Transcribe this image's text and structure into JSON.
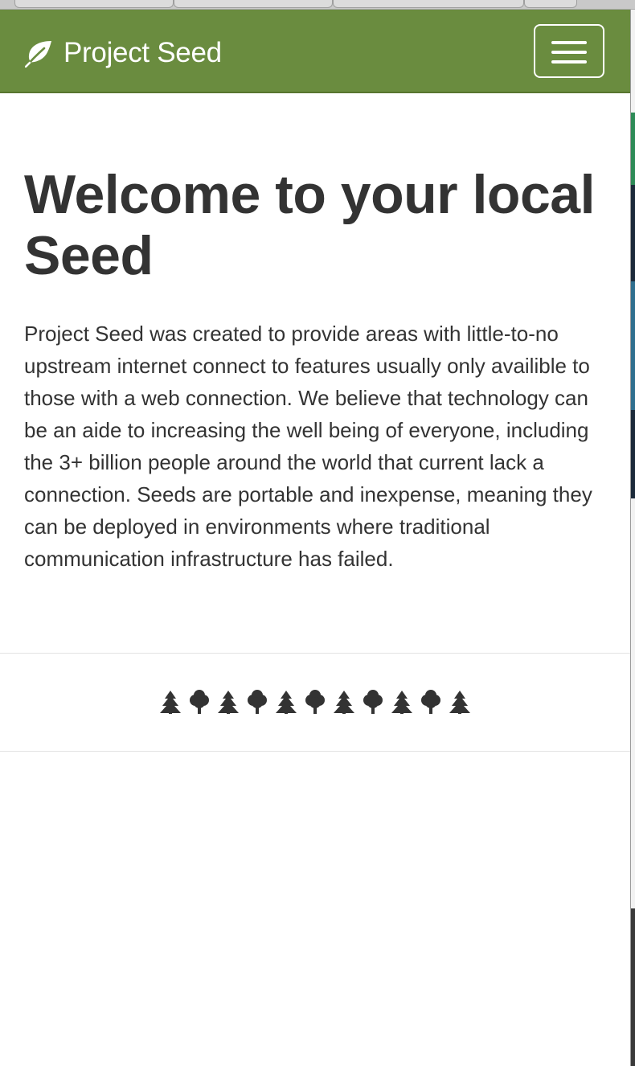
{
  "navbar": {
    "brand_icon": "leaf-icon",
    "brand_label": "Project Seed",
    "menu_icon": "hamburger-menu-icon",
    "background_color": "#6a8c3f"
  },
  "hero": {
    "headline": "Welcome to your local Seed",
    "intro": "Project Seed was created to provide areas with little-to-no upstream internet connect to features usually only availible to those with a web connection. We believe that technology can be an aide to increasing the well being of everyone, including the 3+ billion people around the world that current lack a connection. Seeds are portable and inexpense, meaning they can be deployed in environments where traditional communication infrastructure has failed."
  },
  "tree_row": [
    "pine-tree-icon",
    "deciduous-tree-icon",
    "pine-tree-icon",
    "deciduous-tree-icon",
    "pine-tree-icon",
    "deciduous-tree-icon",
    "pine-tree-icon",
    "deciduous-tree-icon",
    "pine-tree-icon",
    "deciduous-tree-icon",
    "pine-tree-icon"
  ],
  "colors": {
    "text": "#333333",
    "divider": "#e3e3e3"
  }
}
